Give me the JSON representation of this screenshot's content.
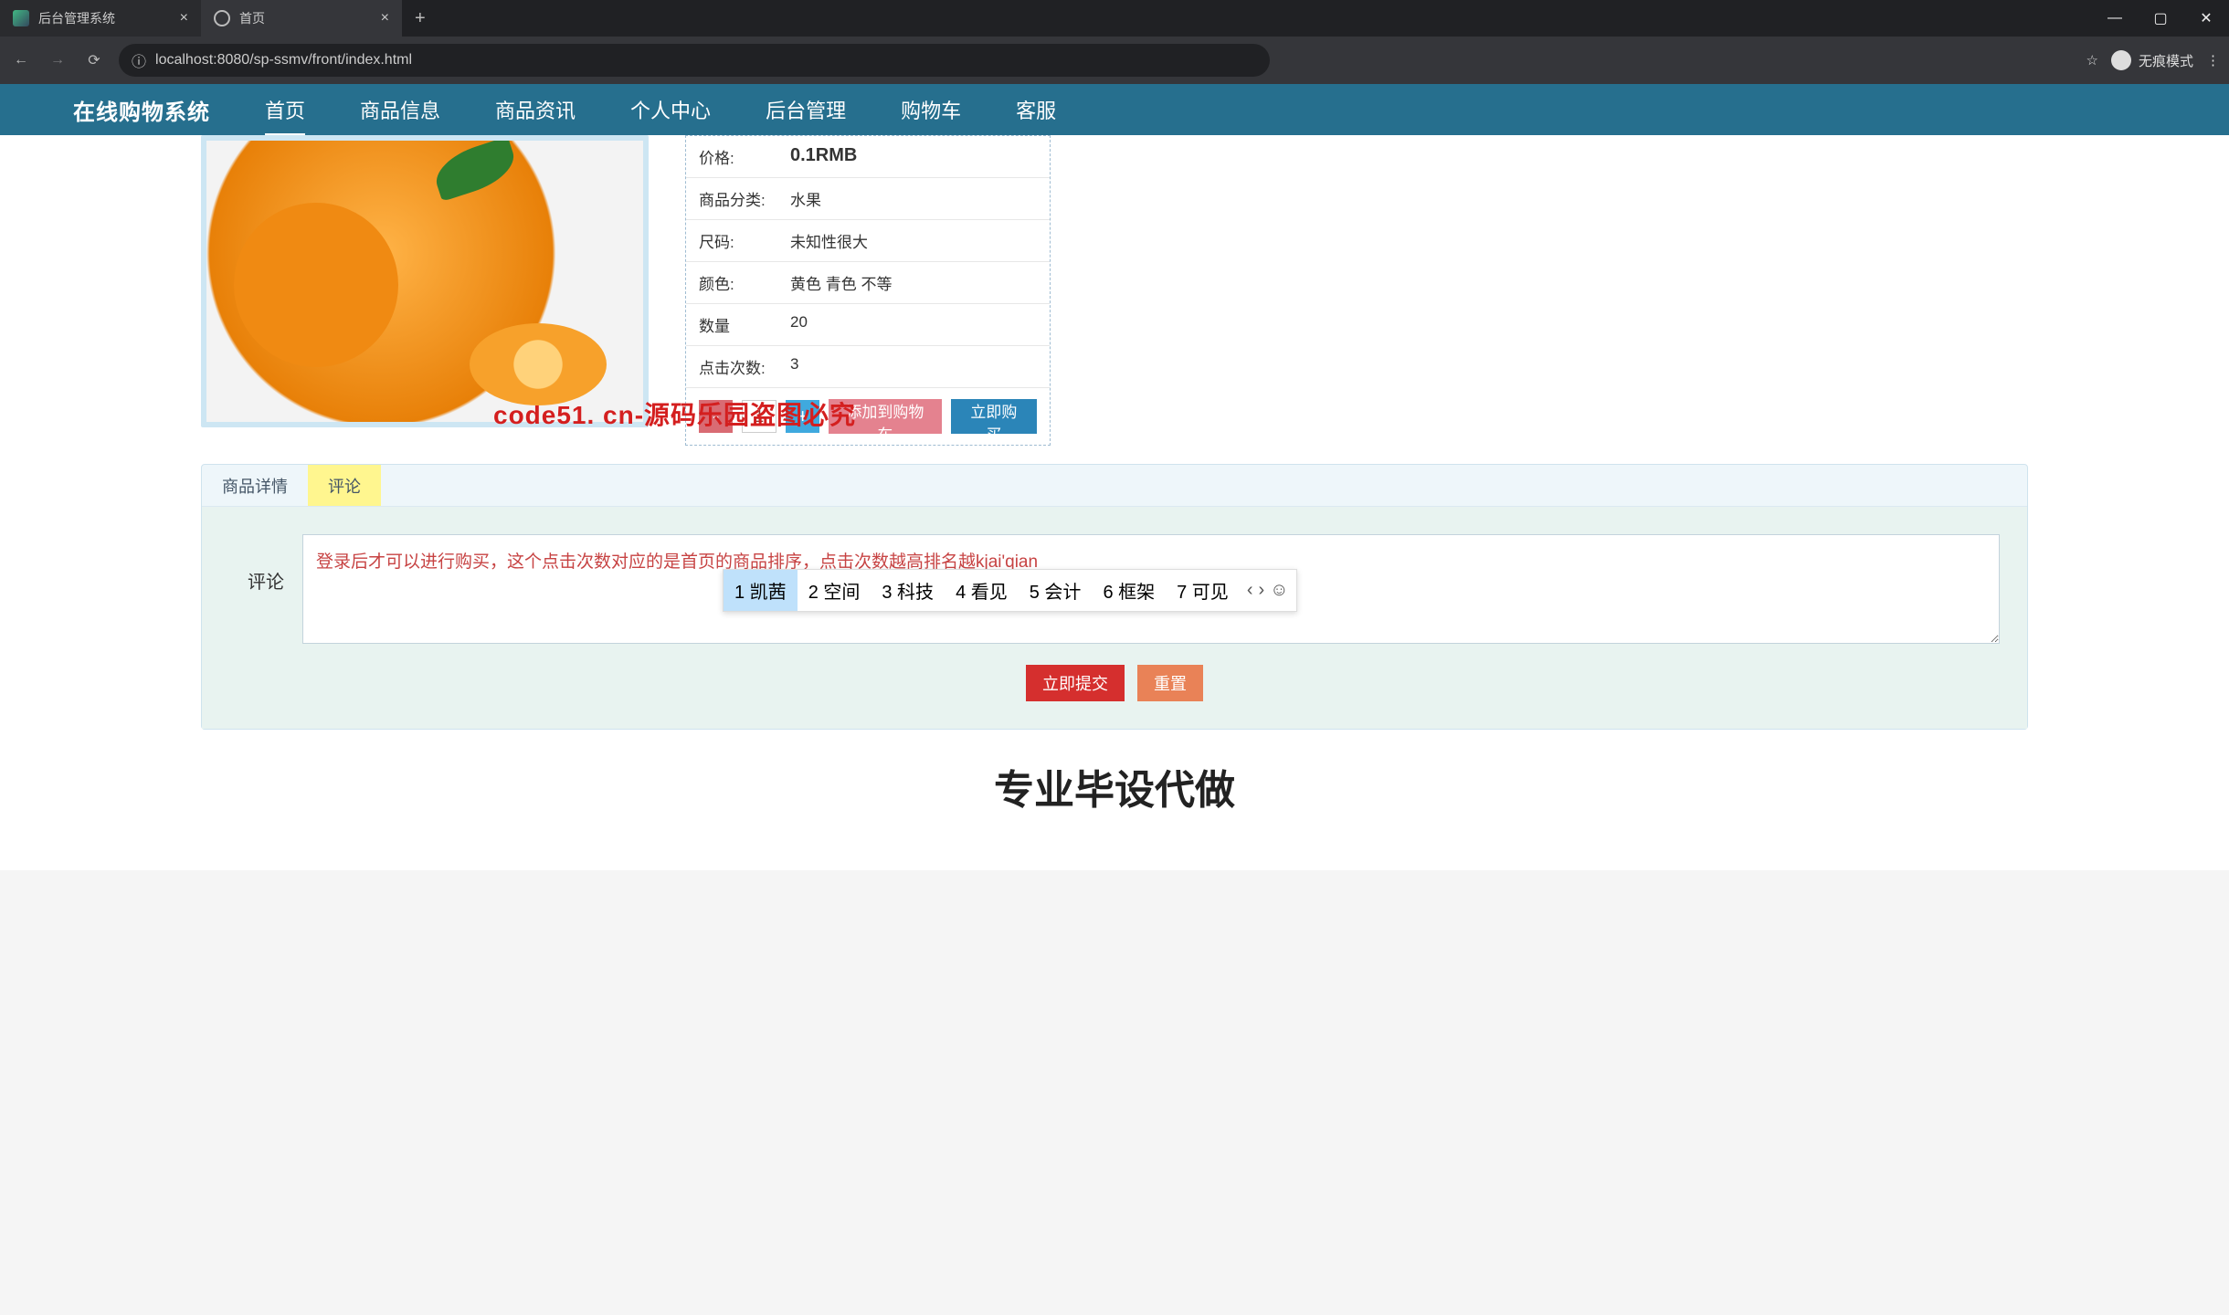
{
  "chrome": {
    "tabs": [
      {
        "title": "后台管理系统"
      },
      {
        "title": "首页"
      }
    ],
    "url": "localhost:8080/sp-ssmv/front/index.html",
    "incognito_label": "无痕模式"
  },
  "watermark_text": "code51.cn",
  "site": {
    "brand": "在线购物系统",
    "nav": [
      "首页",
      "商品信息",
      "商品资讯",
      "个人中心",
      "后台管理",
      "购物车",
      "客服"
    ],
    "active_nav_index": 0
  },
  "product": {
    "info": {
      "price_label": "价格:",
      "price_value": "0.1RMB",
      "category_label": "商品分类:",
      "category_value": "水果",
      "size_label": "尺码:",
      "size_value": "未知性很大",
      "color_label": "颜色:",
      "color_value": "黄色 青色 不等",
      "qty_label": "数量",
      "qty_value": "20",
      "clicks_label": "点击次数:",
      "clicks_value": "3"
    },
    "qty_input": "1",
    "addcart_label": "添加到购物车",
    "buy_label": "立即购买",
    "minus": "-",
    "plus": "+"
  },
  "overlay": "code51. cn-源码乐园盗图必究",
  "panel": {
    "tab_detail": "商品详情",
    "tab_comment": "评论",
    "comment_label": "评论",
    "textarea_value": "登录后才可以进行购买，这个点击次数对应的是首页的商品排序，点击次数越高排名越kjai'qian",
    "submit": "立即提交",
    "reset": "重置"
  },
  "ime": {
    "items": [
      "1 凯茜",
      "2 空间",
      "3 科技",
      "4 看见",
      "5 会计",
      "6 框架",
      "7 可见"
    ],
    "prev": "‹",
    "next": "›",
    "emoji": "☺"
  },
  "banner": "专业毕设代做"
}
